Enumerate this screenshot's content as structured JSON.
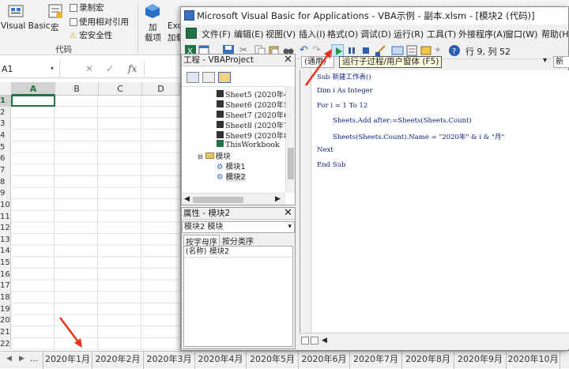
{
  "excel": {
    "ribbon": {
      "visual_basic": "Visual Basic",
      "macro": "宏",
      "record_macro": "录制宏",
      "relative_ref": "使用相对引用",
      "macro_security": "宏安全性",
      "group_code": "代码",
      "add": "加",
      "add2": "载项",
      "exc": "Exc",
      "exc2": "加载"
    },
    "namebox": "A1",
    "fx": "fx",
    "columns": [
      "A",
      "B",
      "C",
      "D"
    ],
    "rows": [
      "1",
      "2",
      "3",
      "4",
      "5",
      "6",
      "7",
      "8",
      "9",
      "10",
      "11",
      "12",
      "13",
      "14",
      "15",
      "16",
      "17",
      "18",
      "19",
      "20",
      "21",
      "22"
    ],
    "sheet_tabs": [
      "2020年1月",
      "2020年2月",
      "2020年3月",
      "2020年4月",
      "2020年5月",
      "2020年6月",
      "2020年7月",
      "2020年8月",
      "2020年9月",
      "2020年10月"
    ],
    "tab_ellipsis": "..."
  },
  "vba": {
    "title": "Microsoft Visual Basic for Applications - VBA示例 - 副本.xlsm - [模块2 (代码)]",
    "menu": [
      "文件(F)",
      "编辑(E)",
      "视图(V)",
      "插入(I)",
      "格式(O)",
      "调试(D)",
      "运行(R)",
      "工具(T)",
      "外接程序(A)",
      "窗口(W)",
      "帮助(H)"
    ],
    "position": "行 9, 列 52",
    "tooltip": "运行子过程/用户窗体 (F5)",
    "project": {
      "title": "工程 - VBAProject",
      "items": [
        "Sheet5 (2020年4",
        "Sheet6 (2020年5",
        "Sheet7 (2020年6",
        "Sheet8 (2020年7",
        "Sheet9 (2020年8",
        "ThisWorkbook"
      ],
      "modules_folder": "模块",
      "modules": [
        "模块1",
        "模块2"
      ]
    },
    "properties": {
      "title": "属性 - 模块2",
      "object": "模块2 模块",
      "tab_alpha": "按字母序",
      "tab_category": "按分类序",
      "row_name": "(名称)",
      "row_value": "模块2"
    },
    "code": {
      "object_combo": "(通用)",
      "proc_combo": "新建",
      "lines": [
        "Sub 新建工作表()",
        "Dim i As Integer",
        "For i = 1 To 12",
        "Sheets.Add after:=Sheets(Sheets.Count)",
        "Sheets(Sheets.Count).Name = \"2020年\" & i & \"月\"",
        "Next",
        "End Sub"
      ]
    }
  },
  "colors": {
    "excel_green": "#217346",
    "annotation_red": "#e8331c",
    "run_green": "#1e9e3a"
  }
}
